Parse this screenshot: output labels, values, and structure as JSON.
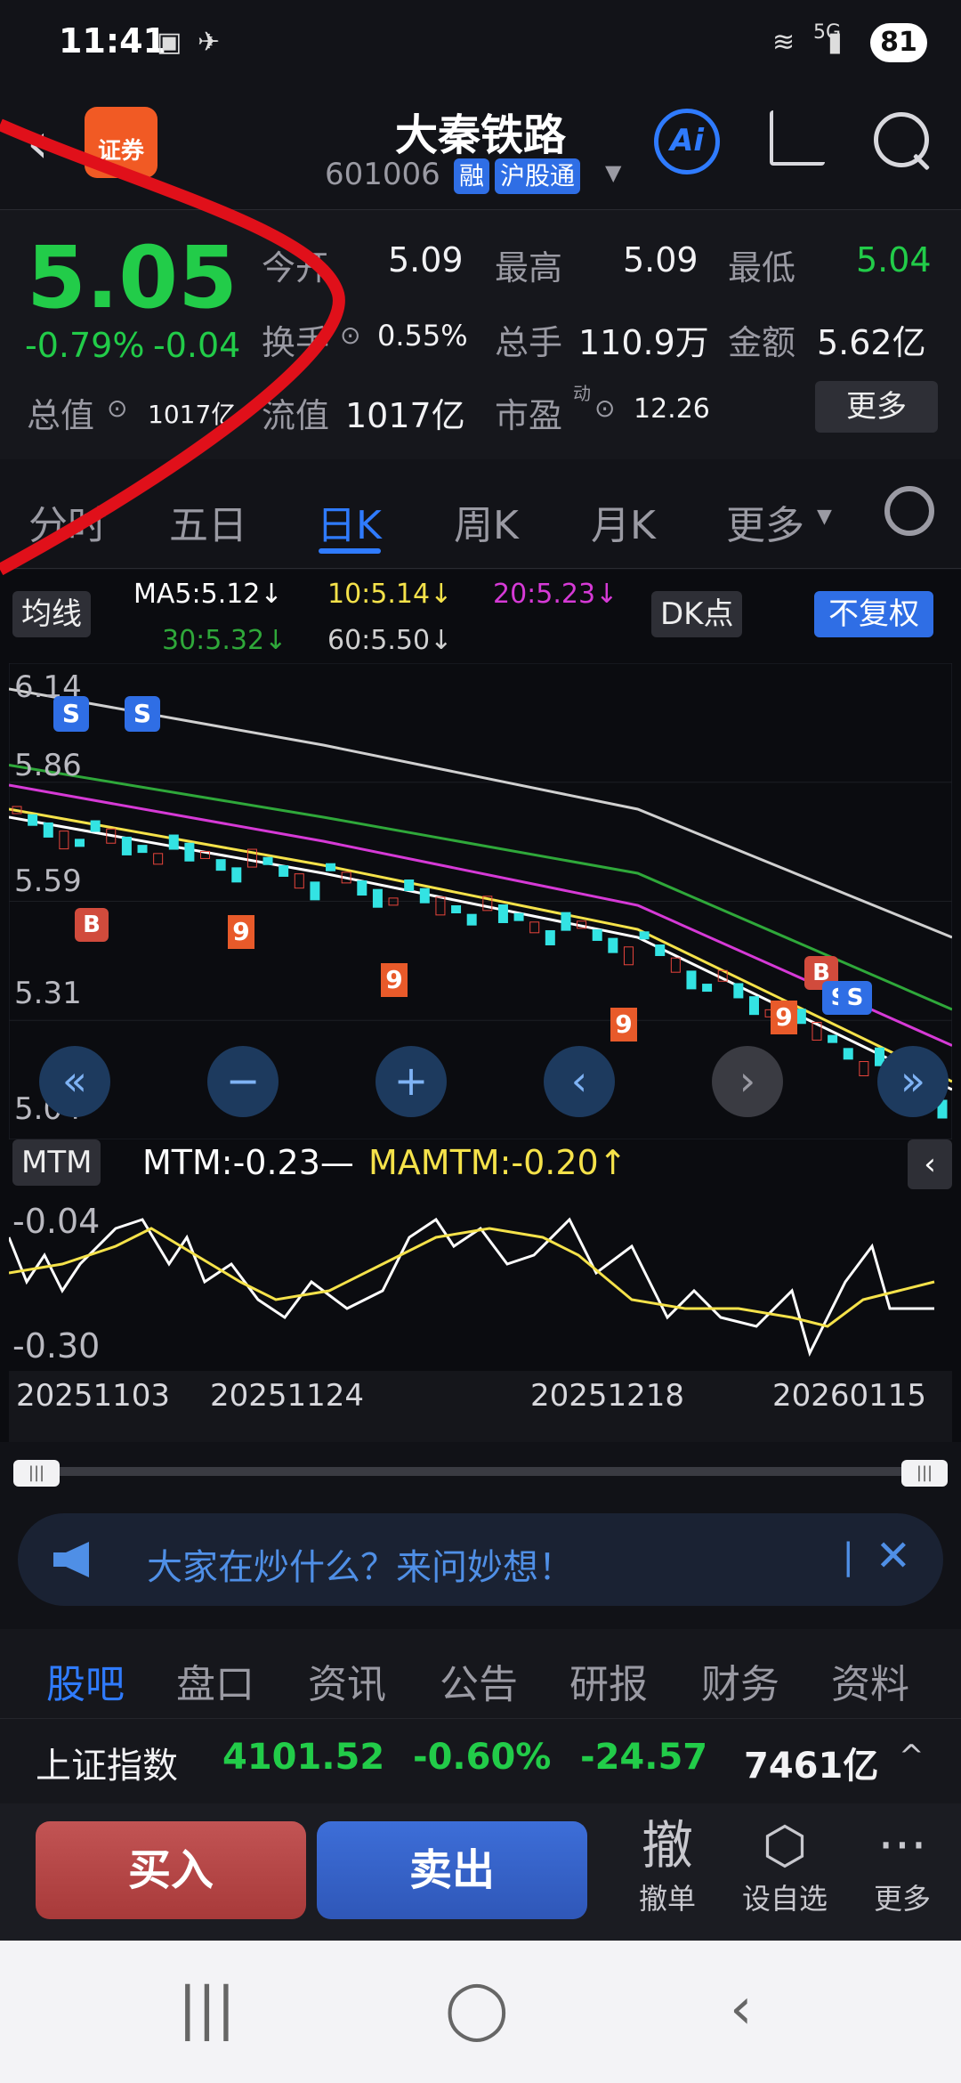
{
  "status": {
    "time": "11:41",
    "battery": "81",
    "signal": "5G"
  },
  "header": {
    "title": "大秦铁路",
    "code": "601006",
    "tags": [
      "融",
      "沪股通"
    ],
    "ai_label": "Ai",
    "broker_label": "证券"
  },
  "quote": {
    "price": "5.05",
    "change_pct": "-0.79%",
    "change": "-0.04",
    "open_label": "今开",
    "open": "5.09",
    "high_label": "最高",
    "high": "5.09",
    "low_label": "最低",
    "low": "5.04",
    "turnover_label": "换手",
    "turnover": "0.55%",
    "volume_label": "总手",
    "volume": "110.9万",
    "amount_label": "金额",
    "amount": "5.62亿",
    "mktcap_label": "总值",
    "mktcap": "1017亿",
    "float_label": "流值",
    "float_cap": "1017亿",
    "pe_label": "市盈",
    "pe_sup": "动",
    "pe": "12.26",
    "more_label": "更多"
  },
  "tabs": [
    "分时",
    "五日",
    "日K",
    "周K",
    "月K",
    "更多"
  ],
  "ma": {
    "mode_label": "均线",
    "ma5": "MA5:5.12↓",
    "ma10": "10:5.14↓",
    "ma20": "20:5.23↓",
    "ma30": "30:5.32↓",
    "ma60": "60:5.50↓",
    "dk_label": "DK点",
    "adjust_label": "不复权"
  },
  "price_axis": [
    "6.14",
    "5.86",
    "5.59",
    "5.31",
    "5.04"
  ],
  "mtm": {
    "indicator": "MTM",
    "mtm_value": "MTM:-0.23—",
    "mamtm_value": "MAMTM:-0.20↑",
    "axis_top": "-0.04",
    "axis_bottom": "-0.30"
  },
  "dates": [
    "20251103",
    "20251124",
    "20251218",
    "20260115"
  ],
  "banner": {
    "text": "大家在炒什么？来问妙想！"
  },
  "footer_tabs": [
    "股吧",
    "盘口",
    "资讯",
    "公告",
    "研报",
    "财务",
    "资料"
  ],
  "index": {
    "name": "上证指数",
    "value": "4101.52",
    "pct": "-0.60%",
    "change": "-24.57",
    "amount": "7461亿"
  },
  "actions": {
    "buy": "买入",
    "sell": "卖出",
    "cancel_big": "撤",
    "cancel": "撤单",
    "watch": "设自选",
    "more": "更多"
  },
  "colors": {
    "up": "#e8453c",
    "down": "#22cc49",
    "accent": "#2f7bff",
    "ma5": "#ffffff",
    "ma10": "#f5e24a",
    "ma20": "#d63ad6",
    "ma30": "#2fa83a",
    "ma60": "#d0d0d0"
  },
  "chart_data": {
    "type": "line",
    "title": "",
    "x": [
      "20251103",
      "20251124",
      "20251218",
      "20260115"
    ],
    "ylim": [
      5.04,
      6.14
    ],
    "series": [
      {
        "name": "MA5",
        "values": [
          5.8,
          5.66,
          5.5,
          5.12
        ]
      },
      {
        "name": "10",
        "values": [
          5.82,
          5.68,
          5.52,
          5.14
        ]
      },
      {
        "name": "20",
        "values": [
          5.88,
          5.74,
          5.58,
          5.23
        ]
      },
      {
        "name": "30",
        "values": [
          5.93,
          5.8,
          5.66,
          5.32
        ]
      },
      {
        "name": "60",
        "values": [
          6.12,
          5.98,
          5.82,
          5.5
        ]
      }
    ]
  }
}
